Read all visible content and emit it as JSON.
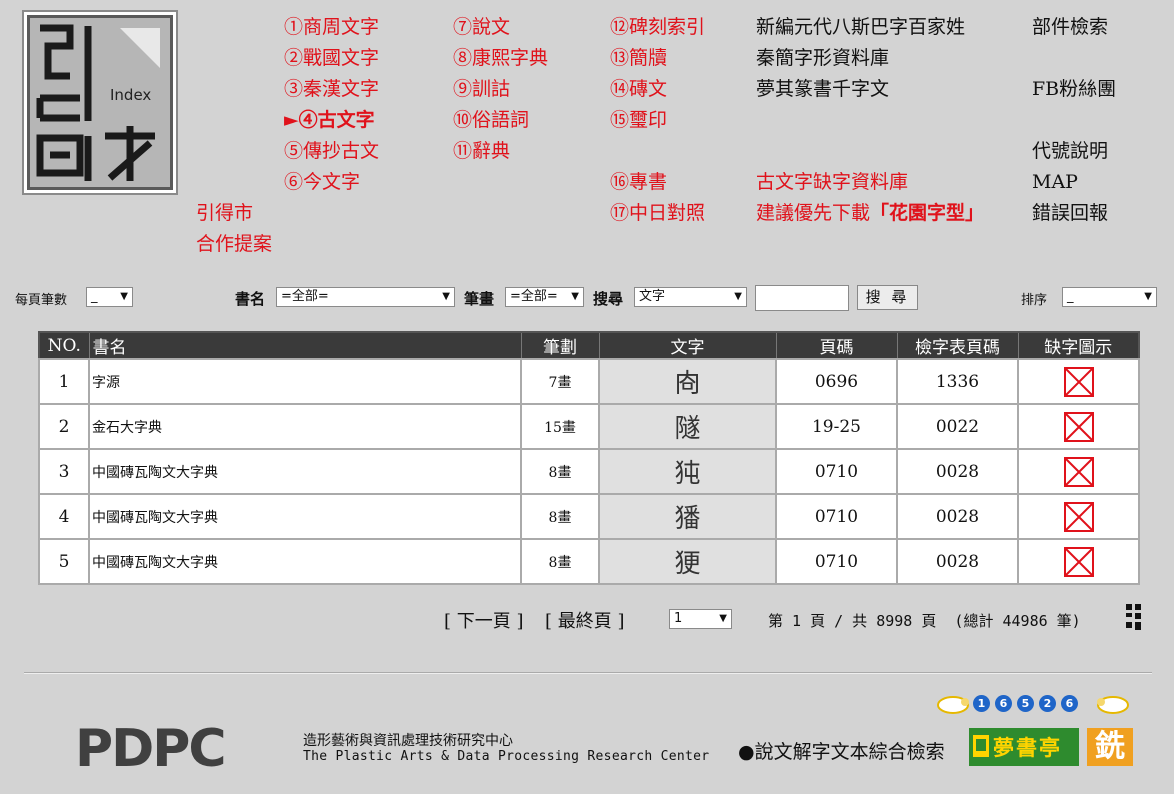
{
  "logo": {
    "text": "Index"
  },
  "nav": {
    "col1": [
      "①商周文字",
      "②戰國文字",
      "③秦漢文字",
      "►④古文字",
      "⑤傳抄古文",
      "⑥今文字"
    ],
    "col2": [
      "⑦說文",
      "⑧康熙字典",
      "⑨訓詁",
      "⑩俗語詞",
      "⑪辭典"
    ],
    "col3": [
      "⑫碑刻索引",
      "⑬簡牘",
      "⑭磚文",
      "⑮璽印",
      "⑯專書",
      "⑰中日對照"
    ],
    "col4_black": [
      "新編元代八斯巴字百家姓",
      "秦簡字形資料庫",
      "夢其篆書千字文"
    ],
    "col4_red": [
      "古文字缺字資料庫",
      "建議優先下載"
    ],
    "font_link": "「花園字型」",
    "col5": [
      "部件檢索",
      "FB粉絲團",
      "代號說明",
      "MAP",
      "錯誤回報"
    ],
    "left_links": [
      "引得市",
      "合作提案"
    ]
  },
  "search": {
    "per_page_label": "每頁筆數",
    "per_page_value": "_",
    "book_label": "書名",
    "book_value": "=全部=",
    "stroke_label": "筆畫",
    "stroke_value": "=全部=",
    "search_label": "搜尋",
    "search_type_value": "文字",
    "search_input_value": "",
    "search_button": "搜 尋",
    "sort_label": "排序",
    "sort_value": "_"
  },
  "table": {
    "headers": [
      "NO.",
      "書名",
      "筆劃",
      "文字",
      "頁碼",
      "檢字表頁碼",
      "缺字圖示"
    ],
    "rows": [
      [
        "1",
        "字源",
        "7畫",
        "㕯",
        "0696",
        "1336"
      ],
      [
        "2",
        "金石大字典",
        "15畫",
        "隧",
        "19-25",
        "0022"
      ],
      [
        "3",
        "中國磚瓦陶文大字典",
        "8畫",
        "㹠",
        "0710",
        "0028"
      ],
      [
        "4",
        "中國磚瓦陶文大字典",
        "8畫",
        "㺕",
        "0710",
        "0028"
      ],
      [
        "5",
        "中國磚瓦陶文大字典",
        "8畫",
        "㹴",
        "0710",
        "0028"
      ]
    ],
    "missing_icon_color": "#e0121b"
  },
  "pagination": {
    "next": "[ 下一頁 ]",
    "last": "[ 最終頁 ]",
    "page_select": "1",
    "status": "第 1 頁 / 共 8998 頁  (總計 44986 筆)"
  },
  "footer": {
    "pdpc": "PDPC",
    "org_zh": "造形藝術與資訊處理技術研究中心",
    "org_en": "The Plastic Arts & Data Processing Research Center",
    "counter_digits": [
      "1",
      "6",
      "5",
      "2",
      "6"
    ],
    "shuowen_link": "●說文解字文本綜合檢索",
    "library_text": "夢書亭",
    "last_logo": "銑"
  },
  "colors": {
    "background": "#d3d3d3",
    "link_red": "#e0121b",
    "header_bg": "#3a3a3a"
  }
}
